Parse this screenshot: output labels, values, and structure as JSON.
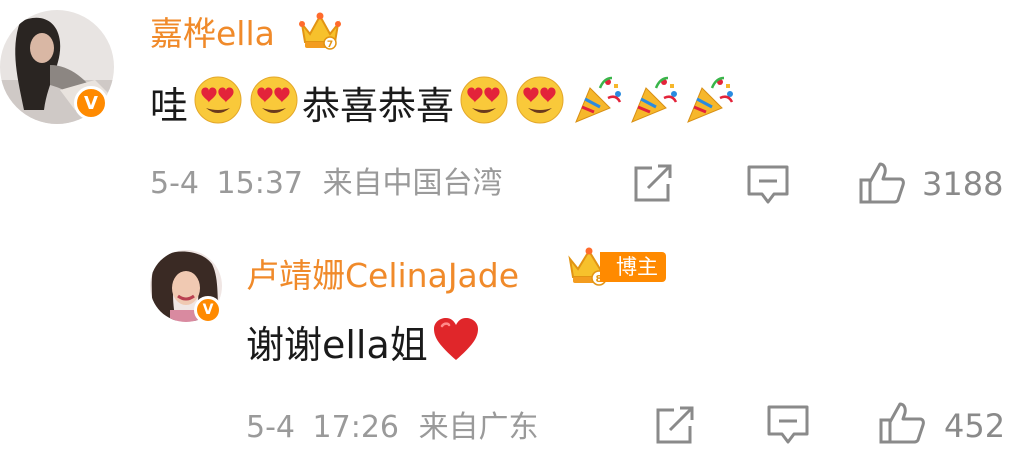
{
  "comment": {
    "username": "嘉桦ella",
    "badge_icon": "crown-icon",
    "text_prefix": "哇",
    "text_middle": "恭喜恭喜",
    "emoji_heart_eyes": "heart-eyes-emoji",
    "emoji_party": "party-popper-emoji",
    "meta_date": "5-4",
    "meta_time": "15:37",
    "meta_location": "来自中国台湾",
    "like_count": "3188"
  },
  "reply": {
    "username": "卢靖姗CelinaJade",
    "badge_icon": "crown-icon",
    "host_label": "博主",
    "text": "谢谢ella姐",
    "emoji_heart": "red-heart-emoji",
    "meta_date": "5-4",
    "meta_time": "17:26",
    "meta_location": "来自广东",
    "like_count": "452"
  },
  "colors": {
    "username": "#f08a2a",
    "meta": "#9a9a9a",
    "badge": "#ff8a00",
    "heart": "#e0262a"
  },
  "icons": [
    "share-icon",
    "comment-icon",
    "thumbs-up-icon",
    "verified-v-icon"
  ]
}
